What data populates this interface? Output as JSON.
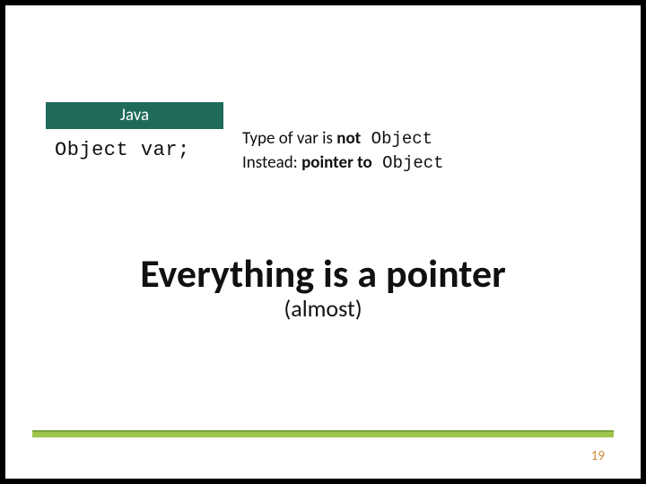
{
  "code_block": {
    "lang_label": "Java",
    "code": "Object var;"
  },
  "type_desc": {
    "l1_prefix": "Type of var is ",
    "l1_bold": "not",
    "l1_mono": " Object",
    "l2_prefix": "Instead: ",
    "l2_bold": "pointer to",
    "l2_mono": " Object"
  },
  "headline": "Everything is a pointer",
  "sub": "(almost)",
  "page_number": "19"
}
